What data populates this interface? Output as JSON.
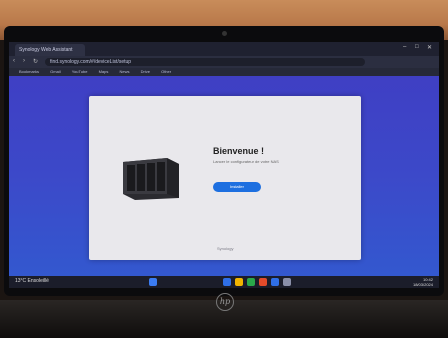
{
  "browser": {
    "tab_title": "Synology Web Assistant",
    "url": "find.synology.com/#/deviceList/setup",
    "bookmarks": [
      "Bookmarks",
      "Gmail",
      "YouTube",
      "Maps",
      "News",
      "Drive",
      "Other"
    ],
    "controls": [
      "‹",
      "›",
      "↻"
    ],
    "window": [
      "–",
      "□",
      "✕"
    ]
  },
  "setup": {
    "title": "Bienvenue !",
    "subtitle": "Lancer le configurateur de votre NAS",
    "button": "Installer",
    "footer": "Synology"
  },
  "taskbar": {
    "weather": "13°C Ensoleillé",
    "time": "10:42",
    "date": "18/03/2024",
    "icon_colors": [
      "#2f6fe7",
      "#f0b400",
      "#2aa84a",
      "#e34b2a",
      "#2f6fe7",
      "#8a8fa8"
    ]
  },
  "device": {
    "brand_logo": "hp"
  }
}
